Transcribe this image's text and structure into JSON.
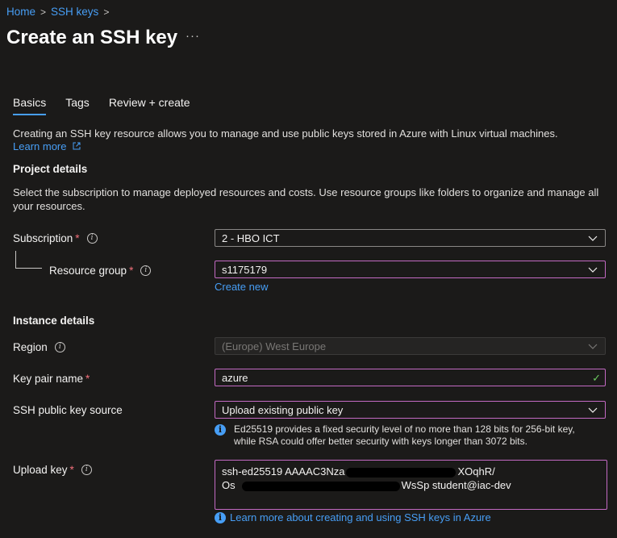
{
  "breadcrumb": {
    "home": "Home",
    "ssh_keys": "SSH keys",
    "separator": ">"
  },
  "page": {
    "title": "Create an SSH key",
    "more": "···"
  },
  "tabs": [
    {
      "label": "Basics"
    },
    {
      "label": "Tags"
    },
    {
      "label": "Review + create"
    }
  ],
  "intro": {
    "text": "Creating an SSH key resource allows you to manage and use public keys stored in Azure with Linux virtual machines.",
    "learn_more": "Learn more"
  },
  "project": {
    "heading": "Project details",
    "description": "Select the subscription to manage deployed resources and costs. Use resource groups like folders to organize and manage all your resources.",
    "subscription_label": "Subscription",
    "subscription_value": "2 - HBO ICT",
    "resource_group_label": "Resource group",
    "resource_group_value": "s1175179",
    "create_new": "Create new"
  },
  "instance": {
    "heading": "Instance details",
    "region_label": "Region",
    "region_value": "(Europe) West Europe",
    "key_pair_label": "Key pair name",
    "key_pair_value": "azure",
    "source_label": "SSH public key source",
    "source_value": "Upload existing public key",
    "note_line1": "Ed25519 provides a fixed security level of no more than 128 bits for 256-bit key,",
    "note_line2": "while RSA could offer better security with keys longer than 3072 bits.",
    "upload_label": "Upload key",
    "upload_line1_start": "ssh-ed25519 AAAAC3Nza",
    "upload_line1_end": "XOqhR/",
    "upload_line2_start": "Os",
    "upload_line2_end": "WsSp student@iac-dev",
    "learn_ssh": "Learn more about creating and using SSH keys in Azure"
  },
  "symbols": {
    "required": "*",
    "info": "i",
    "check": "✓"
  },
  "colors": {
    "accent": "#479ef5",
    "focus_border": "#c36ac3",
    "required": "#f1707b",
    "valid": "#6ccb5f",
    "background": "#1b1a19"
  }
}
